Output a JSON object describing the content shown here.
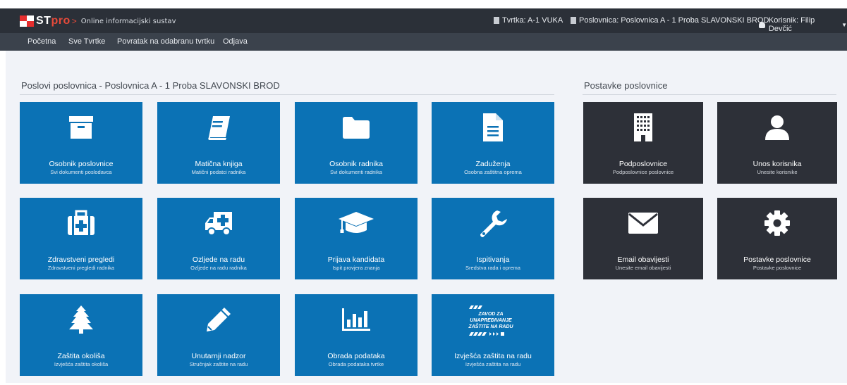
{
  "header": {
    "brand_st": "ST",
    "brand_pro": "pro",
    "brand_arrow": ">",
    "brand_sub": "Online informacijski sustav",
    "company": "Tvrtka: A-1 VUKA",
    "branch": "Poslovnica: Poslovnica A - 1 Proba SLAVONSKI BROD",
    "user": "Korisnik: Filip Devčić"
  },
  "nav": {
    "items": [
      "Početna",
      "Sve Tvrtke",
      "Povratak na odabranu tvrtku",
      "Odjava"
    ]
  },
  "left": {
    "title": "Poslovi poslovnica - Poslovnica A - 1 Proba SLAVONSKI BROD",
    "tiles": [
      {
        "title": "Osobnik poslovnice",
        "sub": "Svi dokumenti poslodavca",
        "icon": "archive-box-icon"
      },
      {
        "title": "Matična knjiga",
        "sub": "Matični podatci radnika",
        "icon": "book-icon"
      },
      {
        "title": "Osobnik radnika",
        "sub": "Svi dokumenti radnika",
        "icon": "folder-icon"
      },
      {
        "title": "Zaduženja",
        "sub": "Osobna zaštitna oprema",
        "icon": "document-icon"
      },
      {
        "title": "Zdravstveni pregledi",
        "sub": "Zdravstveni pregledi radnika",
        "icon": "medkit-icon"
      },
      {
        "title": "Ozljede na radu",
        "sub": "Ozljede na radu radnika",
        "icon": "ambulance-icon"
      },
      {
        "title": "Prijava kandidata",
        "sub": "Ispit provjera znanja",
        "icon": "graduation-cap-icon"
      },
      {
        "title": "Ispitivanja",
        "sub": "Sredstva rada i oprema",
        "icon": "wrench-icon"
      },
      {
        "title": "Zaštita okoliša",
        "sub": "Izvješća zaštita okoliša",
        "icon": "tree-icon"
      },
      {
        "title": "Unutarnji nadzor",
        "sub": "Stručnjak zaštite na radu",
        "icon": "pencil-icon"
      },
      {
        "title": "Obrada podataka",
        "sub": "Obrada podataka tvrtke",
        "icon": "bar-chart-icon"
      },
      {
        "title": "Izvješća zaštita na radu",
        "sub": "Izvješća zaštita na radu",
        "icon": "zzunzr-logo-icon"
      }
    ]
  },
  "zzunzr_logo_lines": [
    "ZAVOD ZA",
    "UNAPREĐIVANJE",
    "ZAŠTITE NA RADU"
  ],
  "right": {
    "title": "Postavke poslovnice",
    "tiles": [
      {
        "title": "Podposlovnice",
        "sub": "Podposlovnice poslovnice",
        "icon": "building-icon"
      },
      {
        "title": "Unos korisnika",
        "sub": "Unesite korisnike",
        "icon": "user-icon"
      },
      {
        "title": "Email obavijesti",
        "sub": "Unesite email obavijesti",
        "icon": "envelope-icon"
      },
      {
        "title": "Postavke poslovnice",
        "sub": "Postavke poslovnice",
        "icon": "gear-icon"
      }
    ]
  },
  "colors": {
    "tile_blue": "#0b72b5",
    "tile_dark": "#2d3038",
    "topbar": "#2b3038",
    "navbar": "#3b424c",
    "brand_red": "#e62e2e"
  }
}
